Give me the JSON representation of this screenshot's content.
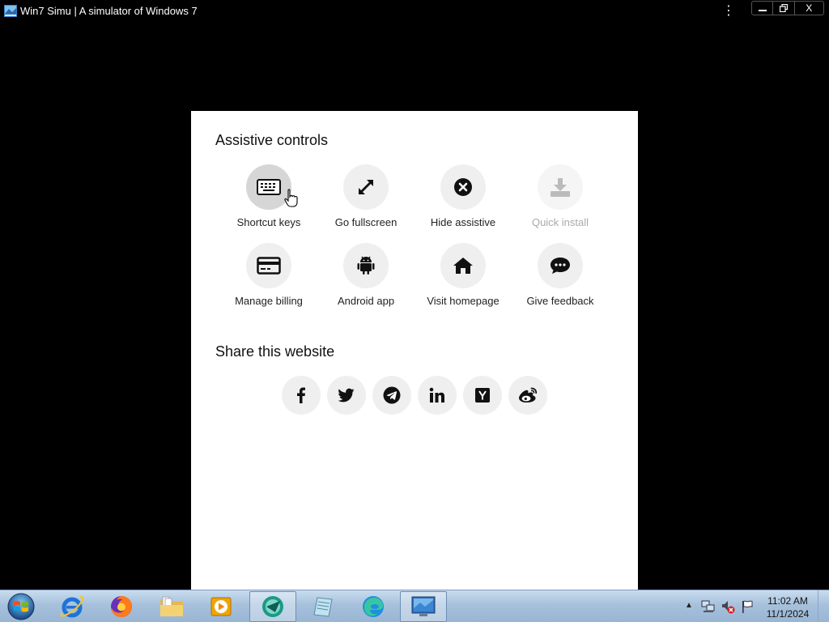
{
  "window": {
    "title": "Win7 Simu | A simulator of Windows 7",
    "menu_icon": "vertical-ellipsis-icon",
    "minimize_icon": "minimize-icon",
    "restore_icon": "restore-icon",
    "close_label": "X"
  },
  "assistive": {
    "title": "Assistive controls",
    "controls": [
      {
        "label": "Shortcut keys",
        "icon": "keyboard-icon",
        "state": "hover"
      },
      {
        "label": "Go fullscreen",
        "icon": "fullscreen-arrows-icon"
      },
      {
        "label": "Hide assistive",
        "icon": "close-circle-icon"
      },
      {
        "label": "Quick install",
        "icon": "download-tray-icon",
        "state": "disabled"
      },
      {
        "label": "Manage billing",
        "icon": "credit-card-icon"
      },
      {
        "label": "Android app",
        "icon": "android-icon"
      },
      {
        "label": "Visit homepage",
        "icon": "home-icon"
      },
      {
        "label": "Give feedback",
        "icon": "chat-bubble-icon"
      }
    ]
  },
  "share": {
    "title": "Share this website",
    "buttons": [
      "facebook-icon",
      "twitter-icon",
      "telegram-icon",
      "linkedin-icon",
      "ycombinator-icon",
      "weibo-icon"
    ]
  },
  "taskbar": {
    "apps": [
      "internet-explorer-icon",
      "firefox-icon",
      "file-explorer-icon",
      "media-player-icon",
      "win7simu-icon",
      "notepad-icon",
      "edge-icon",
      "remote-desktop-icon"
    ],
    "active_apps": [
      "win7simu-icon",
      "remote-desktop-icon"
    ],
    "tray_icons": [
      "show-hidden-icons-arrow",
      "network-icon",
      "volume-muted-icon",
      "action-center-flag-icon"
    ],
    "time": "11:02 AM",
    "date": "11/1/2024"
  },
  "colors": {
    "dialog_bg": "#ffffff",
    "circle_bg": "#efefef",
    "circle_hover": "#d6d6d6",
    "disabled_text": "#aaaaaa",
    "taskbar_top": "#c9dcef",
    "taskbar_bottom": "#98b5d3"
  }
}
